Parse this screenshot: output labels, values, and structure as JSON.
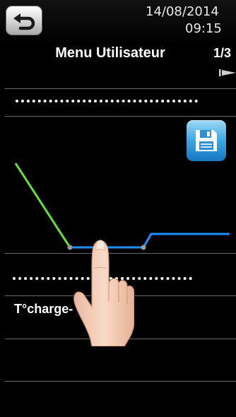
{
  "status_bar": {
    "date": "14/08/2014",
    "time": "09:15",
    "back_icon": "back-arrow-icon"
  },
  "header": {
    "title": "Menu Utilisateur",
    "page_indicator": "1/3",
    "next_icon": "next-page-arrow-icon"
  },
  "fields": [
    {
      "value": ""
    },
    {
      "value": ""
    },
    {
      "label": "T°charge-"
    }
  ],
  "save_icon": "floppy-disk-icon",
  "gesture_icon": "pointing-hand-icon",
  "colors": {
    "background": "#000000",
    "divider": "#6a6a6a",
    "curve_slope": "#63e13a",
    "curve_flat": "#1f8fff",
    "save_button": "#3ba6e3"
  }
}
